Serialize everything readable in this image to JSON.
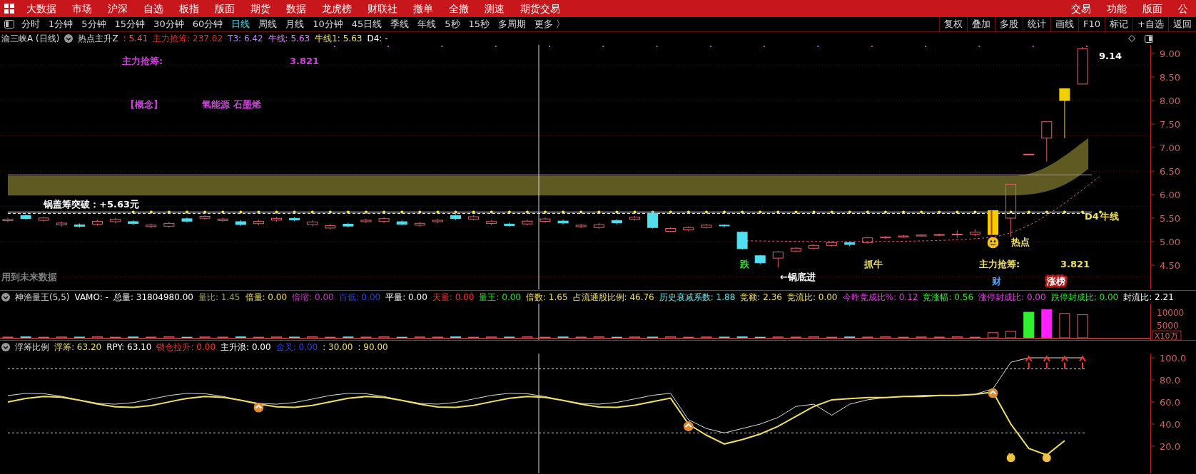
{
  "menu_bar": {
    "items": [
      "大数据",
      "市场",
      "沪深",
      "自选",
      "板指",
      "版面",
      "期货",
      "数据",
      "龙虎榜",
      "财联社",
      "撤单",
      "全撤",
      "测速",
      "期货交易"
    ],
    "right_items": [
      "交易",
      "功能",
      "版面",
      "公"
    ]
  },
  "period_bar": {
    "periods": [
      {
        "label": "分时",
        "selected": false
      },
      {
        "label": "1分钟",
        "selected": false
      },
      {
        "label": "5分钟",
        "selected": false
      },
      {
        "label": "15分钟",
        "selected": false
      },
      {
        "label": "30分钟",
        "selected": false
      },
      {
        "label": "60分钟",
        "selected": false
      },
      {
        "label": "日线",
        "selected": true
      },
      {
        "label": "周线",
        "selected": false
      },
      {
        "label": "月线",
        "selected": false
      },
      {
        "label": "10分钟",
        "selected": false
      },
      {
        "label": "45日线",
        "selected": false
      },
      {
        "label": "季线",
        "selected": false
      },
      {
        "label": "年线",
        "selected": false
      },
      {
        "label": "5秒",
        "selected": false
      },
      {
        "label": "15秒",
        "selected": false
      },
      {
        "label": "多周期",
        "selected": false
      },
      {
        "label": "更多 〉",
        "selected": false
      }
    ],
    "buttons": [
      "复权",
      "叠加",
      "多股",
      "统计",
      "画线",
      "F10",
      "标记",
      "+自选",
      "返回"
    ]
  },
  "main_panel": {
    "title": "渝三峡A (日线)",
    "indicator": "热点主升Z",
    "values": [
      {
        "text": ": 5.41",
        "color": "#ff4d4d"
      },
      {
        "text": "主力抢筹: 237.02",
        "color": "#e03030"
      },
      {
        "text": "T3: 6.42",
        "color": "#c080ff"
      },
      {
        "text": "牛线: 5.63",
        "color": "#e080ff"
      },
      {
        "text": "牛线1: 5.63",
        "color": "#f0e060"
      },
      {
        "text": "D4: -",
        "color": "#ffffff"
      }
    ],
    "labels": [
      {
        "text": "9.14",
        "color": "#ffffff"
      },
      {
        "text": "主力抢筹:",
        "color": "#d040e0"
      },
      {
        "text": "3.821",
        "color": "#d040e0"
      },
      {
        "text": "【概念】",
        "color": "#d040e0"
      },
      {
        "text": "氢能源 石墨烯",
        "color": "#d040e0"
      },
      {
        "text": "锅盖筹突破：+5.63元",
        "color": "#ffffff"
      },
      {
        "text": "D4",
        "color": "#f0e060"
      },
      {
        "text": "牛线",
        "color": "#f0e060"
      },
      {
        "text": "热点",
        "color": "#f0e060"
      },
      {
        "text": "跌",
        "color": "#30e030"
      },
      {
        "text": "抓牛",
        "color": "#f0e060"
      },
      {
        "text": "主力抢筹:",
        "color": "#f0e060"
      },
      {
        "text": "3.821",
        "color": "#f0e060"
      },
      {
        "text": "用到未来数据",
        "color": "#808080"
      },
      {
        "text": "←锅底进",
        "color": "#ffffff"
      },
      {
        "text": "财",
        "color": "#4aa0ff"
      },
      {
        "text": "涨榜",
        "color": "#ffffff"
      }
    ],
    "price_axis": [
      "9.00",
      "8.50",
      "8.00",
      "7.50",
      "7.00",
      "6.50",
      "6.00",
      "5.50",
      "5.00",
      "4.50"
    ]
  },
  "volume_panel": {
    "indicator": "神渔量王(5,5)",
    "values": [
      {
        "text": "VAMO: -",
        "color": "#ffffff"
      },
      {
        "text": "总量: 31804980.00",
        "color": "#ffffff"
      },
      {
        "text": "量比: 1.45",
        "color": "#a0a060"
      },
      {
        "text": "倍量: 0.00",
        "color": "#f0e060"
      },
      {
        "text": "倍缩: 0.00",
        "color": "#c040c0"
      },
      {
        "text": "百低: 0.00",
        "color": "#3040e0"
      },
      {
        "text": "平量: 0.00",
        "color": "#ffffff"
      },
      {
        "text": "天量: 0.00",
        "color": "#ff3030"
      },
      {
        "text": "量王: 0.00",
        "color": "#30e030"
      },
      {
        "text": "倍数: 1.65",
        "color": "#f0e060"
      },
      {
        "text": "占流通股比例: 46.76",
        "color": "#f0e060"
      },
      {
        "text": "历史衰减系数: 1.88",
        "color": "#60e0e0"
      },
      {
        "text": "竞额: 2.36",
        "color": "#f0e060"
      },
      {
        "text": "竞流比: 0.00",
        "color": "#f0e060"
      },
      {
        "text": "今昨竞成比%: 0.12",
        "color": "#e040e0"
      },
      {
        "text": "竞涨幅: 0.56",
        "color": "#30e030"
      },
      {
        "text": "涨停封成比: 0.00",
        "color": "#e040e0"
      },
      {
        "text": "跌停封成比: 0.00",
        "color": "#30e030"
      },
      {
        "text": "封流比: 2.21",
        "color": "#ffffff"
      }
    ],
    "axis": [
      "10000",
      "5000"
    ],
    "unit": "X10万"
  },
  "chip_panel": {
    "indicator": "浮筹比例",
    "values": [
      {
        "text": "浮筹: 63.20",
        "color": "#f0e060"
      },
      {
        "text": "RPY: 63.10",
        "color": "#ffffff"
      },
      {
        "text": "锁仓拉升: 0.00",
        "color": "#ff3030"
      },
      {
        "text": "主升浪: 0.00",
        "color": "#ffffff"
      },
      {
        "text": "金叉: 0.00",
        "color": "#3040e0"
      },
      {
        "text": ": 30.00",
        "color": "#f0e060"
      },
      {
        "text": ": 90.00",
        "color": "#f0e060"
      }
    ],
    "axis": [
      "100.0",
      "80.0",
      "60.0",
      "40.0",
      "20.0"
    ]
  }
}
